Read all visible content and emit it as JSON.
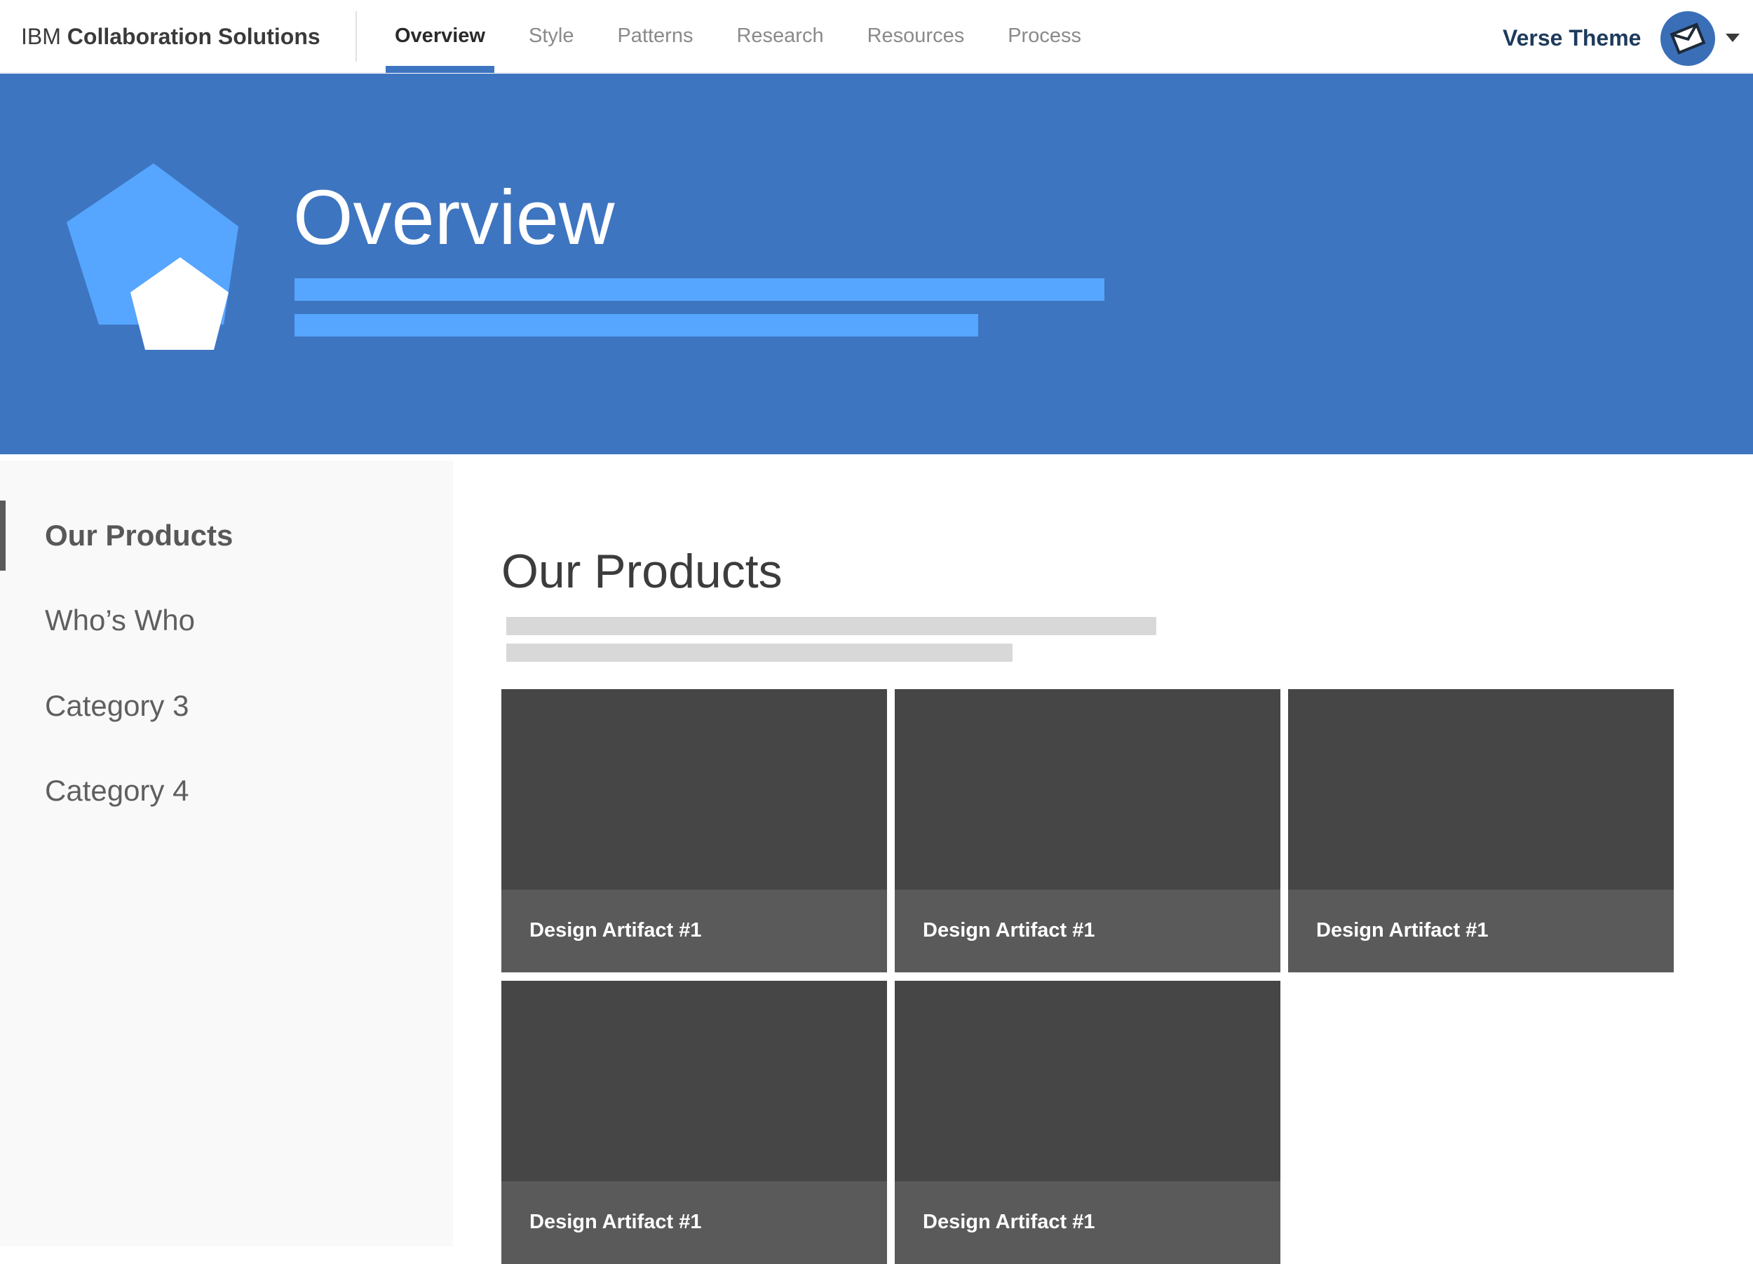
{
  "header": {
    "brand_prefix": "IBM",
    "brand_name": "Collaboration Solutions",
    "nav": [
      {
        "label": "Overview",
        "active": true
      },
      {
        "label": "Style"
      },
      {
        "label": "Patterns"
      },
      {
        "label": "Research"
      },
      {
        "label": "Resources"
      },
      {
        "label": "Process"
      }
    ],
    "theme_label": "Verse Theme",
    "avatar_icon": "verse-envelope-icon",
    "dropdown_icon": "caret-down-icon"
  },
  "hero": {
    "title": "Overview",
    "logo_icon": "pentagon-logo-icon"
  },
  "sidebar": {
    "items": [
      {
        "label": "Our Products",
        "active": true
      },
      {
        "label": "Who’s Who"
      },
      {
        "label": "Category 3"
      },
      {
        "label": "Category 4"
      }
    ]
  },
  "main": {
    "title": "Our Products",
    "cards": [
      {
        "label": "Design Artifact #1"
      },
      {
        "label": "Design Artifact #1"
      },
      {
        "label": "Design Artifact #1"
      },
      {
        "label": "Design Artifact #1"
      },
      {
        "label": "Design Artifact #1"
      }
    ]
  },
  "colors": {
    "accent": "#3e75c1",
    "hero_bar": "#56a6ff",
    "card": "#464646",
    "card_footer": "#5a5a5a"
  }
}
